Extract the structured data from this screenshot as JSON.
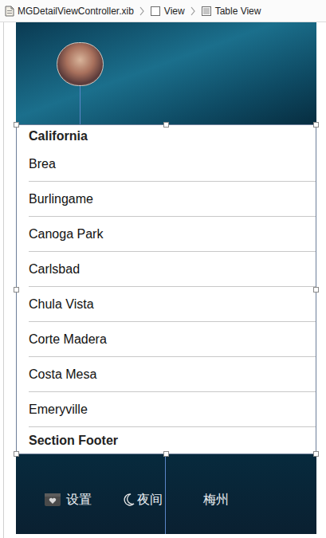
{
  "breadcrumb": [
    {
      "label": "MGDetailViewController.xib",
      "kind": "file"
    },
    {
      "label": "View",
      "kind": "view"
    },
    {
      "label": "Table View",
      "kind": "table"
    }
  ],
  "table": {
    "selected": true,
    "section_header": "California",
    "rows": [
      "Brea",
      "Burlingame",
      "Canoga Park",
      "Carlsbad",
      "Chula Vista",
      "Corte Madera",
      "Costa Mesa",
      "Emeryville"
    ],
    "section_footer": "Section Footer"
  },
  "bottom_bar": [
    {
      "label": "设置",
      "kind": "settings"
    },
    {
      "label": "夜间",
      "kind": "night"
    },
    {
      "label": "梅州",
      "kind": "city"
    }
  ]
}
